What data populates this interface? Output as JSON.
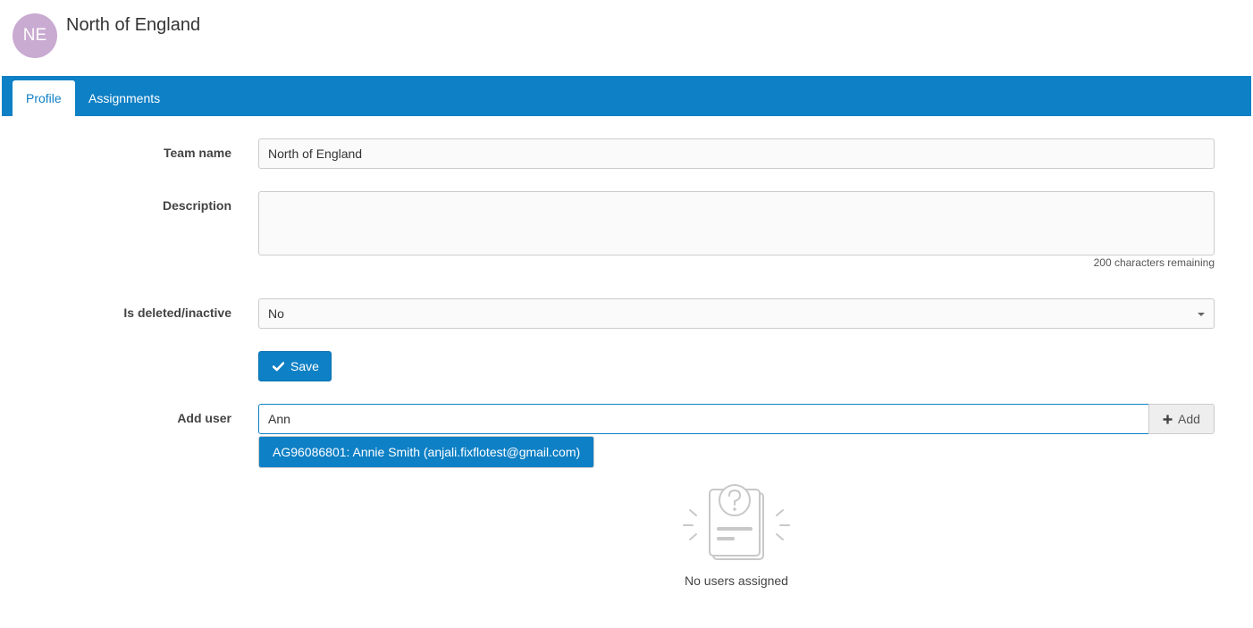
{
  "header": {
    "avatar_initials": "NE",
    "avatar_color": "#c9aad1",
    "title": "North of England"
  },
  "tabs": [
    {
      "label": "Profile",
      "active": true
    },
    {
      "label": "Assignments",
      "active": false
    }
  ],
  "form": {
    "team_name": {
      "label": "Team name",
      "value": "North of England"
    },
    "description": {
      "label": "Description",
      "value": "",
      "remaining": "200 characters remaining"
    },
    "is_deleted": {
      "label": "Is deleted/inactive",
      "value": "No"
    },
    "save_label": "Save",
    "add_user": {
      "label": "Add user",
      "value": "Ann",
      "add_label": "Add",
      "suggestion": "AG96086801: Annie Smith (anjali.fixflotest@gmail.com)"
    }
  },
  "empty_state": {
    "icon": "document-question-icon",
    "text": "No users assigned"
  },
  "colors": {
    "primary": "#0e80c5"
  }
}
